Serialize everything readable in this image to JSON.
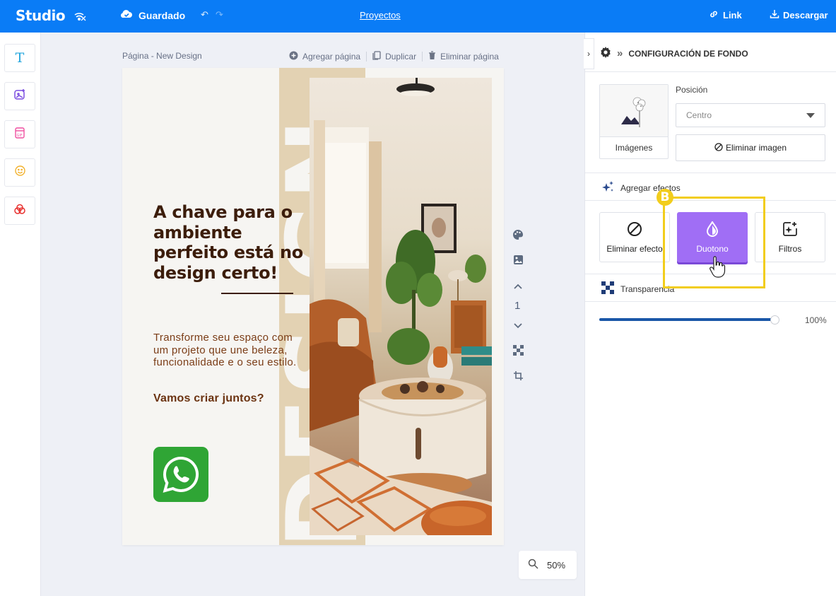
{
  "topbar": {
    "brand": "Studio",
    "save_status": "Guardado",
    "projects_link": "Proyectos",
    "link_button": "Link",
    "download_button": "Descargar"
  },
  "canvas": {
    "page_title": "Página - New Design",
    "add_page": "Agregar página",
    "duplicate": "Duplicar",
    "delete_page": "Eliminar página",
    "page_number": "1",
    "zoom": "50%"
  },
  "design": {
    "headline": "A chave para o ambiente perfeito está no design certo!",
    "body": "Transforme seu espaço com um projeto que une beleza, funcionalidade e o seu estilo.",
    "cta": "Vamos criar juntos?",
    "vertical_word": "DESIGN"
  },
  "panel": {
    "header": "CONFIGURACIÓN DE FONDO",
    "images_label": "Imágenes",
    "position_label": "Posición",
    "position_value": "Centro",
    "delete_image": "Eliminar imagen",
    "effects_header": "Agregar efectos",
    "effects": [
      {
        "label": "Eliminar efecto",
        "icon": "ban-icon"
      },
      {
        "label": "Duotono",
        "icon": "drop-icon",
        "active": true
      },
      {
        "label": "Filtros",
        "icon": "filters-icon"
      }
    ],
    "transparency_header": "Transparencia",
    "transparency_value": "100%",
    "transparency_level": 1.0
  },
  "annotation": {
    "badge": "B",
    "color": "#f2cd1c"
  },
  "colors": {
    "topbar": "#0a7cf6",
    "accent_active": "#a06ef5",
    "headline": "#3c1d0b",
    "beige_strip": "#e3d2b3",
    "whatsapp": "#2fa535"
  }
}
